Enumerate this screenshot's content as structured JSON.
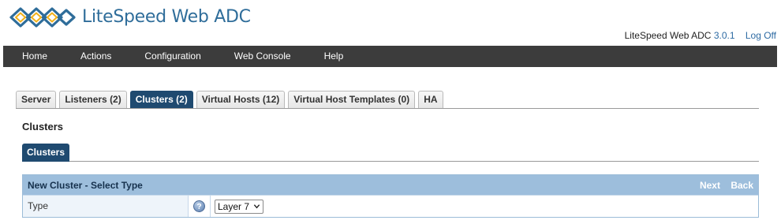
{
  "header": {
    "logo_text": "LiteSpeed Web ADC",
    "product_name": "LiteSpeed Web ADC",
    "version": "3.0.1",
    "logoff_label": "Log Off"
  },
  "nav": {
    "items": [
      {
        "label": "Home"
      },
      {
        "label": "Actions"
      },
      {
        "label": "Configuration"
      },
      {
        "label": "Web Console"
      },
      {
        "label": "Help"
      }
    ]
  },
  "tabs": {
    "items": [
      {
        "label": "Server"
      },
      {
        "label": "Listeners (2)"
      },
      {
        "label": "Clusters (2)",
        "active": true
      },
      {
        "label": "Virtual Hosts (12)"
      },
      {
        "label": "Virtual Host Templates (0)"
      },
      {
        "label": "HA"
      }
    ]
  },
  "section": {
    "title": "Clusters",
    "subtab": "Clusters"
  },
  "panel": {
    "title": "New Cluster - Select Type",
    "next_label": "Next",
    "back_label": "Back",
    "row_label": "Type",
    "help_icon": "?",
    "select_value": "Layer 7"
  },
  "colors": {
    "nav_bg": "#3c3c3c",
    "active_tab": "#1f4a70",
    "panel_header": "#9dbedc",
    "brand_blue": "#2f6d9a"
  }
}
